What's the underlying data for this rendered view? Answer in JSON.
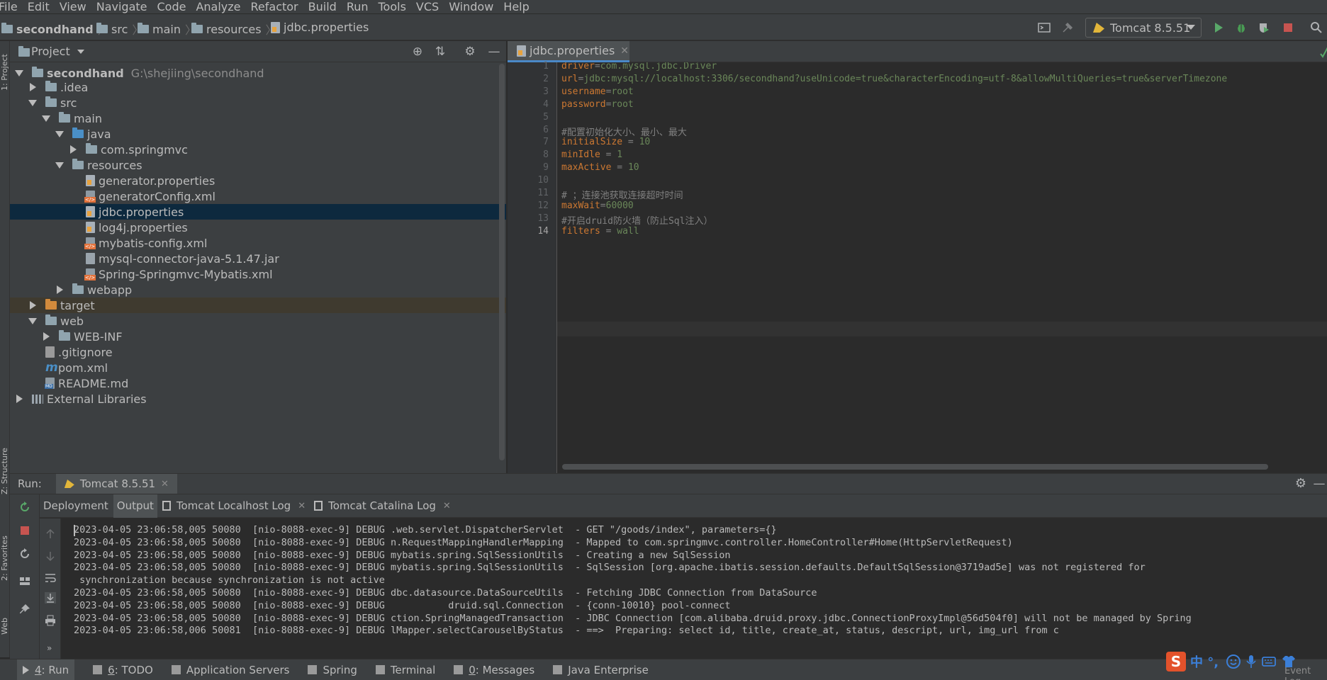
{
  "menu": [
    "File",
    "Edit",
    "View",
    "Navigate",
    "Code",
    "Analyze",
    "Refactor",
    "Build",
    "Run",
    "Tools",
    "VCS",
    "Window",
    "Help"
  ],
  "breadcrumbs": [
    "secondhand",
    "src",
    "main",
    "resources",
    "jdbc.properties"
  ],
  "run_config": {
    "label": "Tomcat 8.5.51"
  },
  "left_stripe": {
    "project": "1: Project",
    "structure": "Z: Structure",
    "favorites": "2: Favorites",
    "web": "Web"
  },
  "project_panel": {
    "title": "Project",
    "root": {
      "name": "secondhand",
      "path": "G:\\shejiing\\secondhand"
    },
    "items": [
      {
        "label": ".idea",
        "indent": 1,
        "arrow": "closed",
        "icon": "folder"
      },
      {
        "label": "src",
        "indent": 1,
        "arrow": "open",
        "icon": "folder"
      },
      {
        "label": "main",
        "indent": 2,
        "arrow": "open",
        "icon": "folder"
      },
      {
        "label": "java",
        "indent": 3,
        "arrow": "open",
        "icon": "folder-blue"
      },
      {
        "label": "com.springmvc",
        "indent": 4,
        "arrow": "closed",
        "icon": "folder"
      },
      {
        "label": "resources",
        "indent": 3,
        "arrow": "open",
        "icon": "folder"
      },
      {
        "label": "generator.properties",
        "indent": 4,
        "arrow": "none",
        "icon": "prop"
      },
      {
        "label": "generatorConfig.xml",
        "indent": 4,
        "arrow": "none",
        "icon": "xml"
      },
      {
        "label": "jdbc.properties",
        "indent": 4,
        "arrow": "none",
        "icon": "prop",
        "selected": true
      },
      {
        "label": "log4j.properties",
        "indent": 4,
        "arrow": "none",
        "icon": "prop"
      },
      {
        "label": "mybatis-config.xml",
        "indent": 4,
        "arrow": "none",
        "icon": "xml"
      },
      {
        "label": "mysql-connector-java-5.1.47.jar",
        "indent": 4,
        "arrow": "none",
        "icon": "jar"
      },
      {
        "label": "Spring-Springmvc-Mybatis.xml",
        "indent": 4,
        "arrow": "none",
        "icon": "xml"
      },
      {
        "label": "webapp",
        "indent": 3,
        "arrow": "closed",
        "icon": "folder"
      },
      {
        "label": "target",
        "indent": 1,
        "arrow": "closed",
        "icon": "folder-orange",
        "excluded": true
      },
      {
        "label": "web",
        "indent": 1,
        "arrow": "open",
        "icon": "folder"
      },
      {
        "label": "WEB-INF",
        "indent": 2,
        "arrow": "closed",
        "icon": "folder"
      },
      {
        "label": ".gitignore",
        "indent": 1,
        "arrow": "none",
        "icon": "git"
      },
      {
        "label": "pom.xml",
        "indent": 1,
        "arrow": "none",
        "icon": "maven"
      },
      {
        "label": "README.md",
        "indent": 1,
        "arrow": "none",
        "icon": "md"
      },
      {
        "label": "External Libraries",
        "indent": 0,
        "arrow": "closed",
        "icon": "lib"
      }
    ]
  },
  "editor": {
    "tab": "jdbc.properties",
    "current_line": 14,
    "lines": [
      {
        "n": "1",
        "key": "driver",
        "op": "=",
        "val": "com.mysql.jdbc.Driver"
      },
      {
        "n": "2",
        "key": "url",
        "op": "=",
        "val": "jdbc:mysql://localhost:3306/secondhand?useUnicode=true&characterEncoding=utf-8&allowMultiQueries=true&serverTimezone"
      },
      {
        "n": "3",
        "key": "username",
        "op": "=",
        "val": "root"
      },
      {
        "n": "4",
        "key": "password",
        "op": "=",
        "val": "root"
      },
      {
        "n": "5",
        "comment": ""
      },
      {
        "n": "6",
        "comment": "#配置初始化大小、最小、最大"
      },
      {
        "n": "7",
        "key": "initialSize",
        "op": " = ",
        "val": "10"
      },
      {
        "n": "8",
        "key": "minIdle",
        "op": " = ",
        "val": "1"
      },
      {
        "n": "9",
        "key": "maxActive",
        "op": " = ",
        "val": "10"
      },
      {
        "n": "10",
        "comment": ""
      },
      {
        "n": "11",
        "comment": "# ；连接池获取连接超时时间"
      },
      {
        "n": "12",
        "key": "maxWait",
        "op": "=",
        "val": "60000"
      },
      {
        "n": "13",
        "comment": "#开启druid防火墙（防止Sql注入）"
      },
      {
        "n": "14",
        "key": "filters",
        "op": " = ",
        "val": "wall"
      }
    ]
  },
  "run_panel": {
    "label": "Run:",
    "tab": "Tomcat 8.5.51",
    "sub_tabs": [
      {
        "label": "Deployment",
        "active": false,
        "closable": false
      },
      {
        "label": "Output",
        "active": true,
        "closable": false
      },
      {
        "label": "Tomcat Localhost Log",
        "active": false,
        "closable": true
      },
      {
        "label": "Tomcat Catalina Log",
        "active": false,
        "closable": true
      }
    ],
    "log": [
      "2023-04-05 23:06:58,005 50080  [nio-8088-exec-9] DEBUG .web.servlet.DispatcherServlet  - GET \"/goods/index\", parameters={}",
      "2023-04-05 23:06:58,005 50080  [nio-8088-exec-9] DEBUG n.RequestMappingHandlerMapping  - Mapped to com.springmvc.controller.HomeController#Home(HttpServletRequest)",
      "2023-04-05 23:06:58,005 50080  [nio-8088-exec-9] DEBUG mybatis.spring.SqlSessionUtils  - Creating a new SqlSession",
      "2023-04-05 23:06:58,005 50080  [nio-8088-exec-9] DEBUG mybatis.spring.SqlSessionUtils  - SqlSession [org.apache.ibatis.session.defaults.DefaultSqlSession@3719ad5e] was not registered for",
      " synchronization because synchronization is not active",
      "2023-04-05 23:06:58,005 50080  [nio-8088-exec-9] DEBUG dbc.datasource.DataSourceUtils  - Fetching JDBC Connection from DataSource",
      "2023-04-05 23:06:58,005 50080  [nio-8088-exec-9] DEBUG           druid.sql.Connection  - {conn-10010} pool-connect",
      "2023-04-05 23:06:58,005 50080  [nio-8088-exec-9] DEBUG ction.SpringManagedTransaction  - JDBC Connection [com.alibaba.druid.proxy.jdbc.ConnectionProxyImpl@56d504f0] will not be managed by Spring",
      "2023-04-05 23:06:58,006 50081  [nio-8088-exec-9] DEBUG lMapper.selectCarouselByStatus  - ==>  Preparing: select id, title, create_at, status, descript, url, img_url from c"
    ]
  },
  "bottom_bar": [
    {
      "num": "4",
      "label": ": Run",
      "active": true
    },
    {
      "num": "6",
      "label": ": TODO"
    },
    {
      "num": "",
      "label": "Application Servers"
    },
    {
      "num": "",
      "label": "Spring"
    },
    {
      "num": "",
      "label": "Terminal"
    },
    {
      "num": "0",
      "label": ": Messages"
    },
    {
      "num": "",
      "label": "Java Enterprise"
    }
  ],
  "event_log": "Event Log",
  "ime": {
    "logo": "S",
    "text": "中 °,"
  }
}
